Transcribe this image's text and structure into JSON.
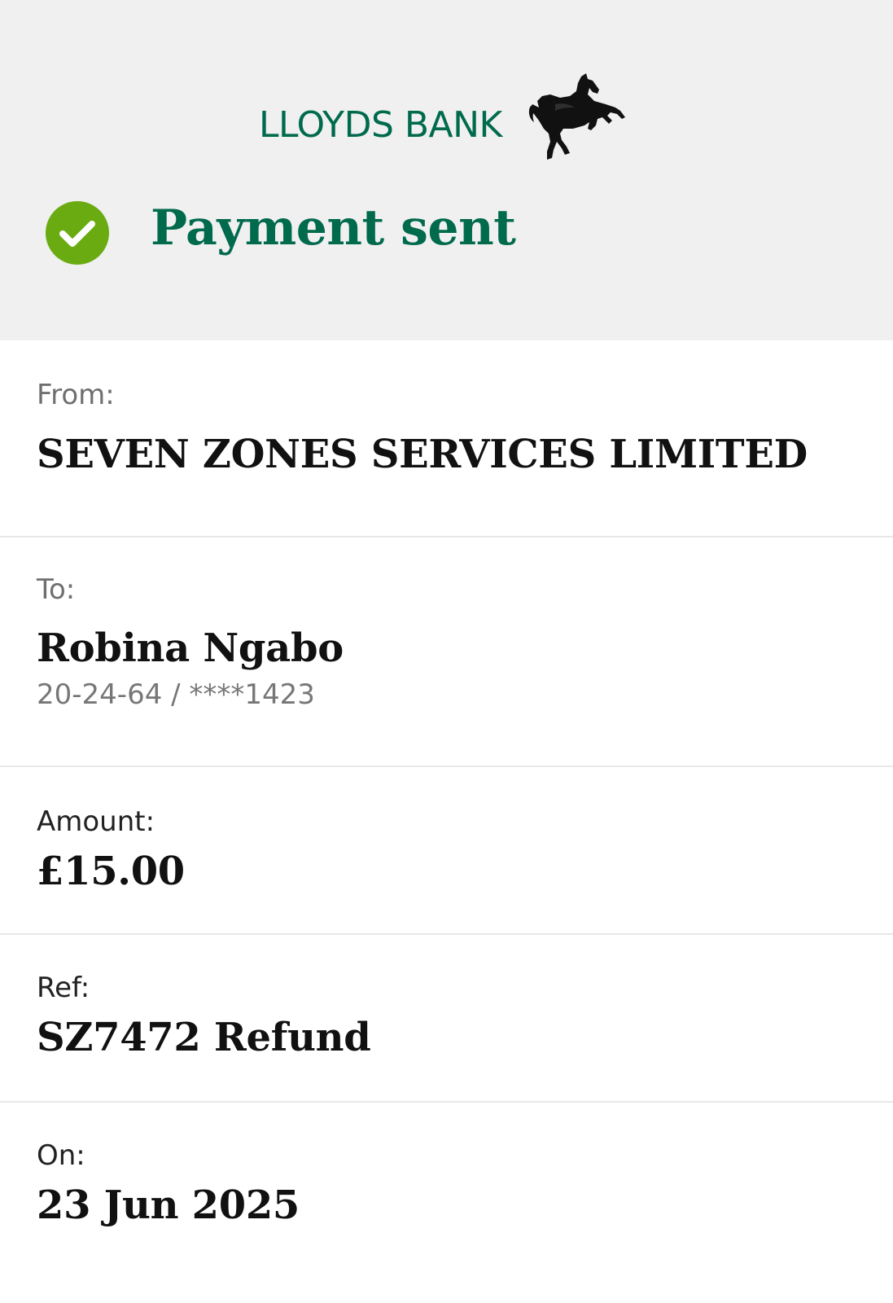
{
  "brand": {
    "name": "LLOYDS BANK",
    "logo": "black-horse-icon",
    "color": "#006a4d"
  },
  "status": {
    "title": "Payment sent",
    "icon": "check-circle-icon",
    "icon_color": "#6aab12"
  },
  "details": {
    "from": {
      "label": "From:",
      "value": "SEVEN ZONES SERVICES LIMITED"
    },
    "to": {
      "label": "To:",
      "value": "Robina Ngabo",
      "account": "20-24-64 / ****1423"
    },
    "amount": {
      "label": "Amount:",
      "value": "£15.00"
    },
    "ref": {
      "label": "Ref:",
      "value": "SZ7472 Refund"
    },
    "on": {
      "label": "On:",
      "value": "23 Jun 2025"
    }
  }
}
